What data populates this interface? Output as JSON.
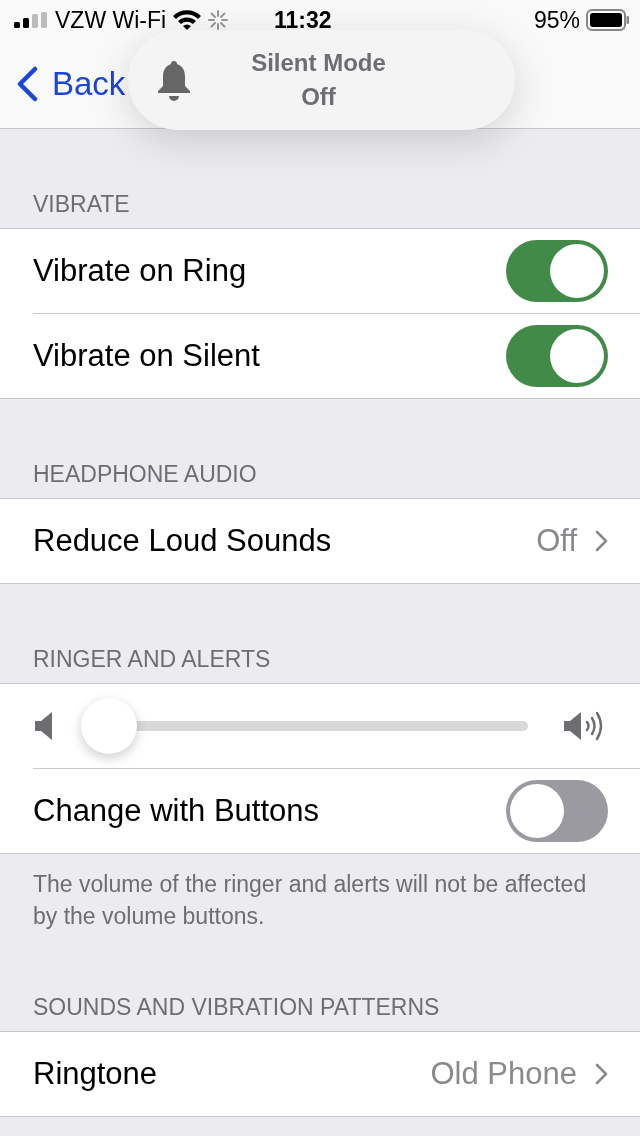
{
  "status_bar": {
    "carrier": "VZW Wi-Fi",
    "time": "11:32",
    "battery": "95%"
  },
  "nav_bar": {
    "back": "Back"
  },
  "hud": {
    "title": "Silent Mode",
    "value": "Off"
  },
  "sections": [
    {
      "header": "VIBRATE",
      "rows": [
        {
          "kind": "toggle",
          "label": "Vibrate on Ring",
          "on": true
        },
        {
          "kind": "toggle",
          "label": "Vibrate on Silent",
          "on": true
        }
      ]
    },
    {
      "header": "HEADPHONE AUDIO",
      "rows": [
        {
          "kind": "link",
          "label": "Reduce Loud Sounds",
          "value": "Off"
        }
      ]
    },
    {
      "header": "RINGER AND ALERTS",
      "rows": [
        {
          "kind": "slider",
          "level": 0.0
        },
        {
          "kind": "toggle",
          "label": "Change with Buttons",
          "on": false
        }
      ],
      "footer": "The volume of the ringer and alerts will not be affected by the volume buttons."
    },
    {
      "header": "SOUNDS AND VIBRATION PATTERNS",
      "rows": [
        {
          "kind": "link",
          "label": "Ringtone",
          "value": "Old Phone"
        }
      ]
    }
  ]
}
